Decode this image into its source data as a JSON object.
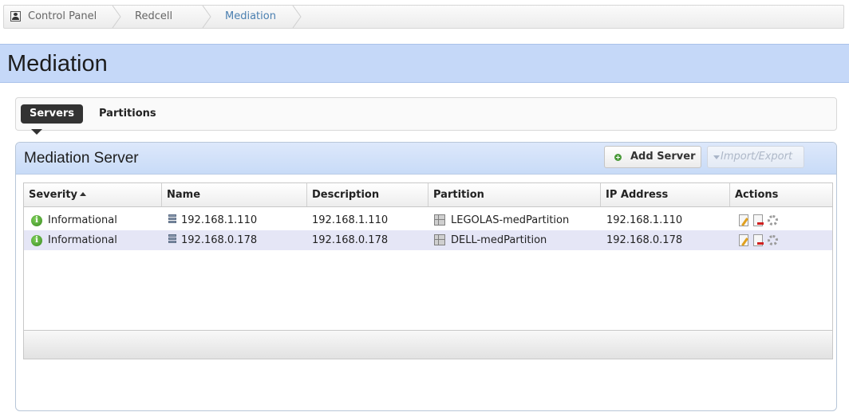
{
  "breadcrumb": {
    "items": [
      {
        "label": "Control Panel"
      },
      {
        "label": "Redcell"
      },
      {
        "label": "Mediation"
      }
    ]
  },
  "page": {
    "title": "Mediation"
  },
  "tabs": [
    {
      "label": "Servers",
      "selected": true
    },
    {
      "label": "Partitions",
      "selected": false
    }
  ],
  "panel": {
    "title": "Mediation Server",
    "add_label": "Add Server",
    "import_label": "Import/Export"
  },
  "table": {
    "columns": [
      "Severity",
      "Name",
      "Description",
      "Partition",
      "IP Address",
      "Actions"
    ],
    "sort_column": "Severity",
    "rows": [
      {
        "severity": "Informational",
        "name": "192.168.1.110",
        "description": "192.168.1.110",
        "partition": "LEGOLAS-medPartition",
        "ip": "192.168.1.110"
      },
      {
        "severity": "Informational",
        "name": "192.168.0.178",
        "description": "192.168.0.178",
        "partition": "DELL-medPartition",
        "ip": "192.168.0.178"
      }
    ]
  },
  "icons": {
    "home": "user-home-icon",
    "severity": "info-icon",
    "server": "server-icon",
    "partition": "partition-icon",
    "edit": "edit-icon",
    "delete": "delete-icon",
    "settings": "gear-icon",
    "add": "plus-icon"
  },
  "colors": {
    "title_band": "#c5d8f8",
    "active_crumb": "#4a7fb0",
    "alt_row": "#e5e6f6",
    "tab_selected": "#333333"
  }
}
